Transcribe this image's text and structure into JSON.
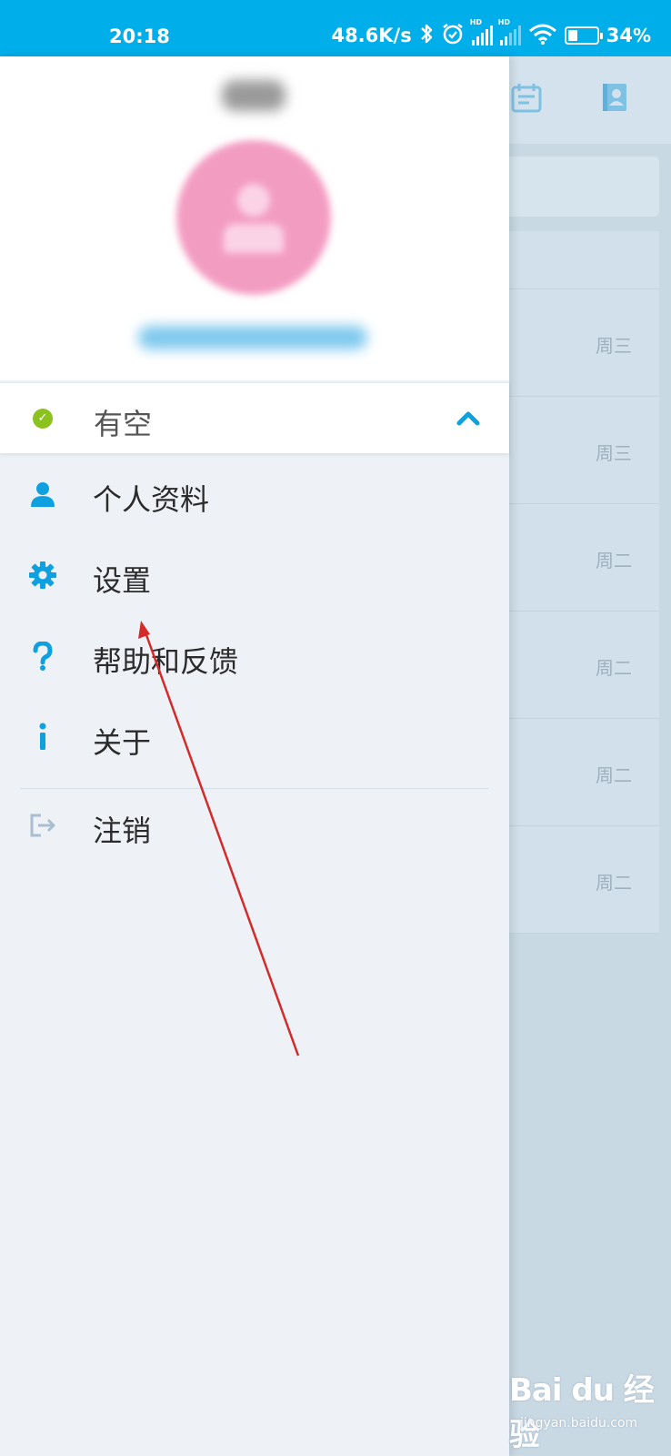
{
  "status_bar": {
    "time": "20:18",
    "net_speed": "48.6K/s",
    "battery_pct": "34",
    "battery_unit": "%",
    "battery_level": 0.34,
    "hd_label": "HD"
  },
  "drawer": {
    "presence": {
      "label": "有空",
      "status_color": "#8bc220",
      "icon": "check-icon",
      "expand_icon": "chevron-up-icon"
    },
    "menu": [
      {
        "label": "个人资料",
        "icon": "person-icon"
      },
      {
        "label": "设置",
        "icon": "gear-icon"
      },
      {
        "label": "帮助和反馈",
        "icon": "question-icon"
      },
      {
        "label": "关于",
        "icon": "info-icon"
      },
      {
        "label": "注销",
        "icon": "sign-out-icon"
      }
    ],
    "accent_color": "#0fa0e0"
  },
  "background_list": {
    "days": [
      "周三",
      "周三",
      "周二",
      "周二",
      "周二",
      "周二"
    ]
  },
  "watermark": {
    "main": "Bai du 经验",
    "sub": "jingyan.baidu.com"
  }
}
